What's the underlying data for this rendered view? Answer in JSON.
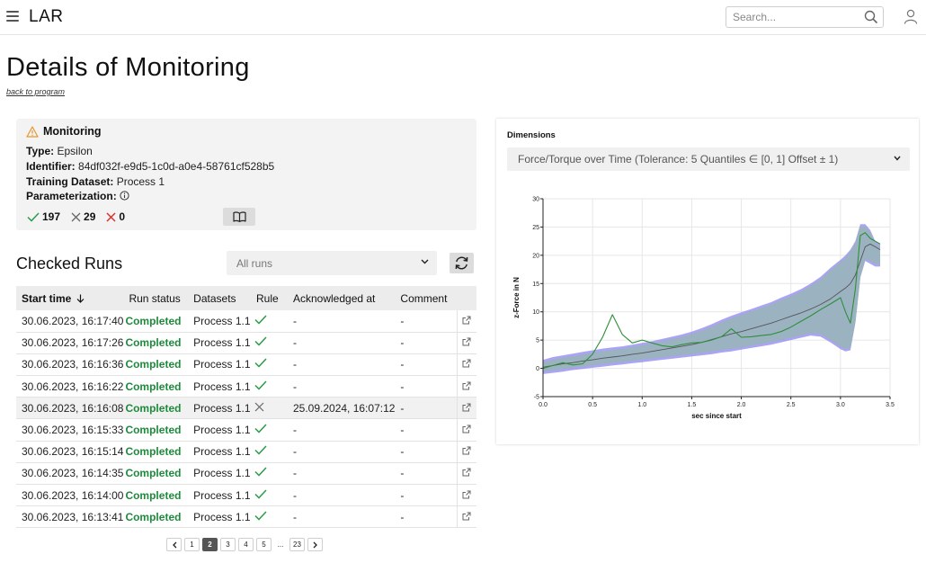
{
  "app": {
    "title": "LAR"
  },
  "search": {
    "placeholder": "Search..."
  },
  "page": {
    "title": "Details of Monitoring",
    "back_link": "back to program"
  },
  "monitoring": {
    "heading": "Monitoring",
    "type_label": "Type:",
    "type_value": "Epsilon",
    "identifier_label": "Identifier:",
    "identifier_value": "84df032f-e9d5-1c0d-a0e4-58761cf528b5",
    "training_label": "Training Dataset:",
    "training_value": "Process 1",
    "param_label": "Parameterization:",
    "counts": {
      "ok": "197",
      "neutral": "29",
      "fail": "0"
    },
    "colors": {
      "ok": "#2e9b49",
      "fail": "#d9302c",
      "warn": "#e8962d"
    }
  },
  "runs": {
    "title": "Checked Runs",
    "filter_value": "All runs",
    "columns": [
      "Start time",
      "Run status",
      "Datasets",
      "Rule",
      "Acknowledged at",
      "Comment"
    ],
    "rows": [
      {
        "start": "30.06.2023, 16:17:40",
        "status": "Completed",
        "dataset": "Process 1.1",
        "rule": "ok",
        "ack": "-",
        "comment": "-"
      },
      {
        "start": "30.06.2023, 16:17:26",
        "status": "Completed",
        "dataset": "Process 1.1",
        "rule": "ok",
        "ack": "-",
        "comment": "-"
      },
      {
        "start": "30.06.2023, 16:16:36",
        "status": "Completed",
        "dataset": "Process 1.1",
        "rule": "ok",
        "ack": "-",
        "comment": "-"
      },
      {
        "start": "30.06.2023, 16:16:22",
        "status": "Completed",
        "dataset": "Process 1.1",
        "rule": "ok",
        "ack": "-",
        "comment": "-"
      },
      {
        "start": "30.06.2023, 16:16:08",
        "status": "Completed",
        "dataset": "Process 1.1",
        "rule": "fail",
        "ack": "25.09.2024, 16:07:12",
        "comment": "-"
      },
      {
        "start": "30.06.2023, 16:15:33",
        "status": "Completed",
        "dataset": "Process 1.1",
        "rule": "ok",
        "ack": "-",
        "comment": "-"
      },
      {
        "start": "30.06.2023, 16:15:14",
        "status": "Completed",
        "dataset": "Process 1.1",
        "rule": "ok",
        "ack": "-",
        "comment": "-"
      },
      {
        "start": "30.06.2023, 16:14:35",
        "status": "Completed",
        "dataset": "Process 1.1",
        "rule": "ok",
        "ack": "-",
        "comment": "-"
      },
      {
        "start": "30.06.2023, 16:14:00",
        "status": "Completed",
        "dataset": "Process 1.1",
        "rule": "ok",
        "ack": "-",
        "comment": "-"
      },
      {
        "start": "30.06.2023, 16:13:41",
        "status": "Completed",
        "dataset": "Process 1.1",
        "rule": "ok",
        "ack": "-",
        "comment": "-"
      }
    ],
    "status_color": "#1e8a3c"
  },
  "pagination": {
    "pages": [
      "1",
      "2",
      "3",
      "4",
      "5",
      "...",
      "23"
    ],
    "current": "2"
  },
  "dimensions": {
    "label": "Dimensions",
    "selected": "Force/Torque over Time (Tolerance: 5 Quantiles ∈ [0, 1] Offset ± 1)"
  },
  "chart_data": {
    "type": "line",
    "xlabel": "sec since start",
    "ylabel": "z-Force in N",
    "xlim": [
      0,
      3.5
    ],
    "ylim": [
      -5,
      30
    ],
    "x_ticks": [
      "0.0",
      "0.5",
      "1.0",
      "1.5",
      "2.0",
      "2.5",
      "3.0",
      "3.5"
    ],
    "y_ticks": [
      "-5",
      "0",
      "5",
      "10",
      "15",
      "20",
      "25",
      "30"
    ],
    "grid": true,
    "x": [
      0.0,
      0.1,
      0.2,
      0.3,
      0.4,
      0.5,
      0.6,
      0.7,
      0.8,
      0.9,
      1.0,
      1.1,
      1.2,
      1.3,
      1.4,
      1.5,
      1.6,
      1.7,
      1.8,
      1.9,
      2.0,
      2.1,
      2.2,
      2.3,
      2.4,
      2.5,
      2.6,
      2.7,
      2.8,
      2.9,
      3.0,
      3.05,
      3.1,
      3.15,
      3.2,
      3.25,
      3.3,
      3.35,
      3.4
    ],
    "series": [
      {
        "role": "outer_band_upper",
        "color": "#8f86f0",
        "values": [
          1.5,
          2.0,
          2.3,
          2.6,
          2.9,
          3.2,
          3.5,
          3.7,
          3.9,
          4.2,
          4.5,
          4.8,
          5.2,
          5.6,
          6.0,
          6.5,
          7.1,
          7.8,
          8.6,
          9.3,
          9.9,
          10.5,
          11.1,
          11.7,
          12.5,
          13.2,
          14.0,
          15.0,
          16.2,
          17.8,
          19.2,
          20.0,
          21.0,
          22.5,
          25.5,
          25.5,
          24.5,
          22.5,
          22.0
        ]
      },
      {
        "role": "outer_band_lower",
        "color": "#8f86f0",
        "values": [
          -1.0,
          -0.8,
          -0.6,
          -0.3,
          -0.1,
          0.1,
          0.3,
          0.5,
          0.7,
          0.9,
          1.1,
          1.3,
          1.5,
          1.7,
          1.9,
          2.1,
          2.3,
          2.5,
          2.8,
          3.0,
          3.3,
          3.6,
          3.9,
          4.2,
          4.6,
          5.0,
          5.4,
          5.8,
          5.6,
          4.6,
          3.4,
          3.0,
          3.2,
          8.0,
          16.0,
          19.0,
          18.5,
          18.0,
          18.0
        ]
      },
      {
        "role": "inner_band_upper",
        "color": "#9ab3bd",
        "values": [
          1.0,
          1.5,
          1.8,
          2.1,
          2.4,
          2.7,
          3.0,
          3.2,
          3.4,
          3.7,
          4.0,
          4.3,
          4.7,
          5.1,
          5.5,
          6.0,
          6.6,
          7.3,
          8.1,
          8.8,
          9.4,
          10.0,
          10.6,
          11.2,
          12.0,
          12.7,
          13.5,
          14.5,
          15.7,
          17.3,
          18.7,
          19.5,
          20.5,
          22.0,
          25.0,
          25.0,
          24.0,
          22.0,
          21.5
        ]
      },
      {
        "role": "inner_band_lower",
        "color": "#9ab3bd",
        "values": [
          -0.5,
          -0.3,
          -0.1,
          0.2,
          0.4,
          0.6,
          0.8,
          1.0,
          1.2,
          1.4,
          1.6,
          1.8,
          2.0,
          2.2,
          2.4,
          2.6,
          2.8,
          3.0,
          3.3,
          3.5,
          3.8,
          4.1,
          4.4,
          4.7,
          5.1,
          5.5,
          5.9,
          6.3,
          6.1,
          5.1,
          3.9,
          3.5,
          3.7,
          8.5,
          16.5,
          19.5,
          19.0,
          18.5,
          18.5
        ]
      },
      {
        "role": "median",
        "color": "#555555",
        "values": [
          0.2,
          0.5,
          0.8,
          1.0,
          1.3,
          1.5,
          1.8,
          2.0,
          2.2,
          2.5,
          2.7,
          3.0,
          3.3,
          3.6,
          3.9,
          4.2,
          4.6,
          5.1,
          5.6,
          6.1,
          6.5,
          7.0,
          7.5,
          8.0,
          8.6,
          9.2,
          9.8,
          10.5,
          11.3,
          12.3,
          13.6,
          14.2,
          15.0,
          16.5,
          19.0,
          21.5,
          22.0,
          21.5,
          21.0
        ]
      },
      {
        "role": "run",
        "color": "#2d8f3a",
        "values": [
          0.0,
          0.5,
          1.0,
          0.6,
          0.8,
          2.5,
          5.5,
          9.5,
          6.0,
          4.5,
          5.0,
          4.5,
          4.0,
          3.8,
          4.2,
          4.5,
          4.6,
          5.0,
          5.6,
          7.0,
          5.5,
          5.6,
          5.8,
          6.0,
          6.5,
          7.3,
          8.3,
          9.3,
          10.4,
          11.4,
          12.5,
          10.0,
          8.0,
          14.0,
          23.5,
          24.0,
          23.0,
          22.5,
          22.0
        ]
      }
    ]
  }
}
